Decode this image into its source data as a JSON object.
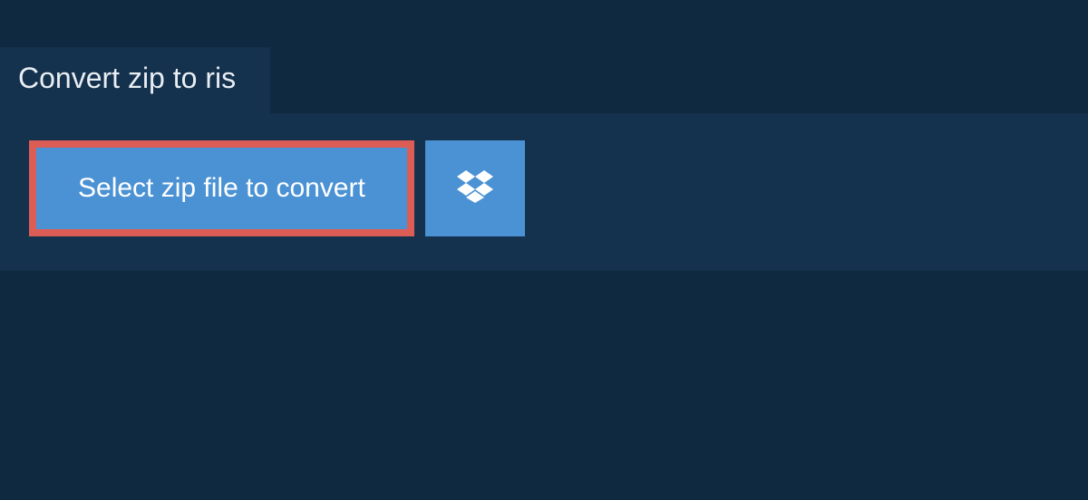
{
  "tab": {
    "label": "Convert zip to ris"
  },
  "actions": {
    "select_label": "Select zip file to convert"
  },
  "colors": {
    "page_bg": "#0f2a40",
    "panel_bg": "#14314d",
    "button_bg": "#4b92d4",
    "highlight_border": "#db5d55",
    "text_light": "#ffffff"
  },
  "icons": {
    "dropbox": "dropbox-icon"
  }
}
